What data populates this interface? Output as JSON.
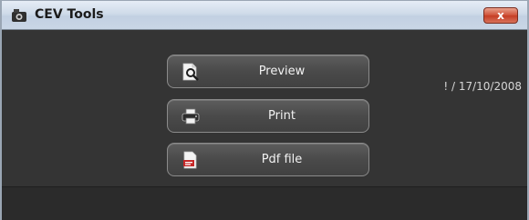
{
  "window": {
    "title": "CEV Tools",
    "close_label": "x"
  },
  "header": {
    "date_text": "! / 17/10/2008"
  },
  "buttons": [
    {
      "label": "Preview",
      "icon": "preview-icon"
    },
    {
      "label": "Print",
      "icon": "printer-icon"
    },
    {
      "label": "Pdf file",
      "icon": "pdf-icon"
    }
  ],
  "colors": {
    "window_bg": "#343434",
    "button_bg": "#4a4a4a",
    "close_button": "#c53d24"
  }
}
